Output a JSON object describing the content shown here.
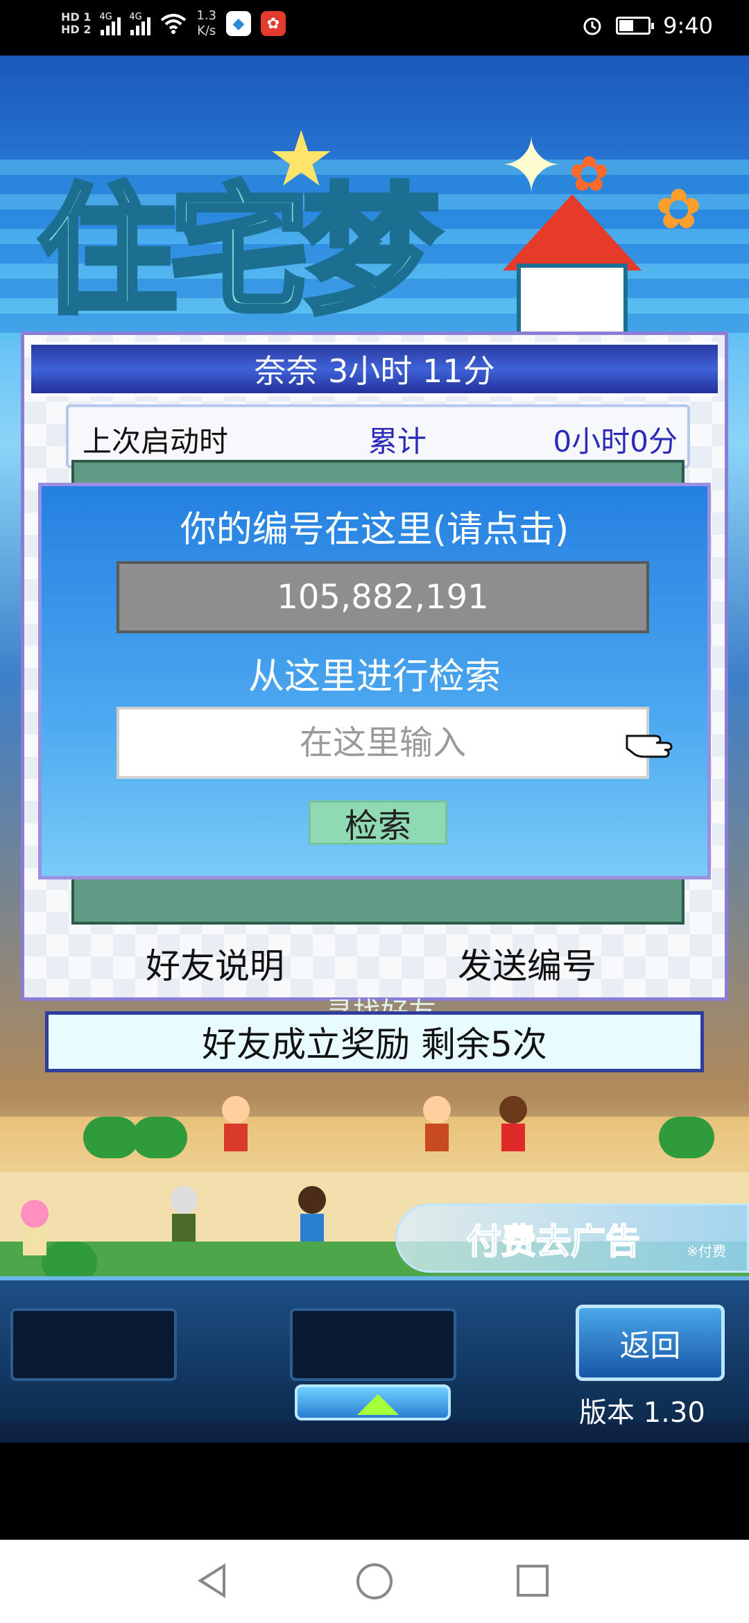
{
  "status_bar": {
    "network": [
      "HD 1",
      "HD 2"
    ],
    "signal_labels": [
      "4G",
      "4G"
    ],
    "speed": "1.3\nK/s",
    "time": "9:40"
  },
  "game": {
    "panel": {
      "title": "奈奈  3小时 11分",
      "last_launch_label": "上次启动时",
      "total_label": "累计",
      "total_value": "0小时0分",
      "find_friend_label": "寻找好友",
      "friend_help": "好友说明",
      "send_id": "发送编号"
    },
    "dialog": {
      "id_prompt": "你的编号在这里(请点击)",
      "id_value": "105,882,191",
      "search_prompt": "从这里进行检索",
      "search_placeholder": "在这里输入",
      "search_button": "检索"
    },
    "bonus_bar": "好友成立奖励  剩余5次",
    "ad": {
      "label": "付费去广告",
      "note": "※付费"
    },
    "bottom": {
      "back_button": "返回",
      "version": "版本 1.30"
    }
  },
  "colors": {
    "panel_border": "#8b7cd6",
    "dialog_top": "#2480e0",
    "title_bar": "#3f63d8",
    "search_button": "#8fd9b3"
  }
}
